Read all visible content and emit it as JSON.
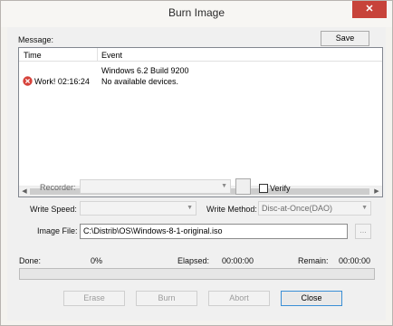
{
  "window": {
    "title": "Burn Image",
    "close_glyph": "✕"
  },
  "message": {
    "label": "Message:",
    "save_label": "Save",
    "columns": [
      "Time",
      "Event"
    ],
    "rows": [
      {
        "time": "",
        "event": "Windows 6.2 Build 9200",
        "icon": ""
      },
      {
        "time": "Work! 02:16:24",
        "event": "No available devices.",
        "icon": "error-icon"
      }
    ]
  },
  "recorder": {
    "label": "Recorder:",
    "value": "",
    "verify_label": "Verify",
    "verify_checked": false
  },
  "write_speed": {
    "label": "Write Speed:",
    "value": ""
  },
  "write_method": {
    "label": "Write Method:",
    "value": "Disc-at-Once(DAO)"
  },
  "image_file": {
    "label": "Image File:",
    "value": "C:\\Distrib\\OS\\Windows-8-1-original.iso",
    "browse_label": "..."
  },
  "status": {
    "done_label": "Done:",
    "done_value": "0%",
    "elapsed_label": "Elapsed:",
    "elapsed_value": "00:00:00",
    "remain_label": "Remain:",
    "remain_value": "00:00:00",
    "progress_fraction": 0
  },
  "buttons": {
    "erase": "Erase",
    "burn": "Burn",
    "abort": "Abort",
    "close": "Close"
  },
  "colors": {
    "error": "#d6423a",
    "progress": "#06b025",
    "default_button_border": "#3a8fd6"
  }
}
